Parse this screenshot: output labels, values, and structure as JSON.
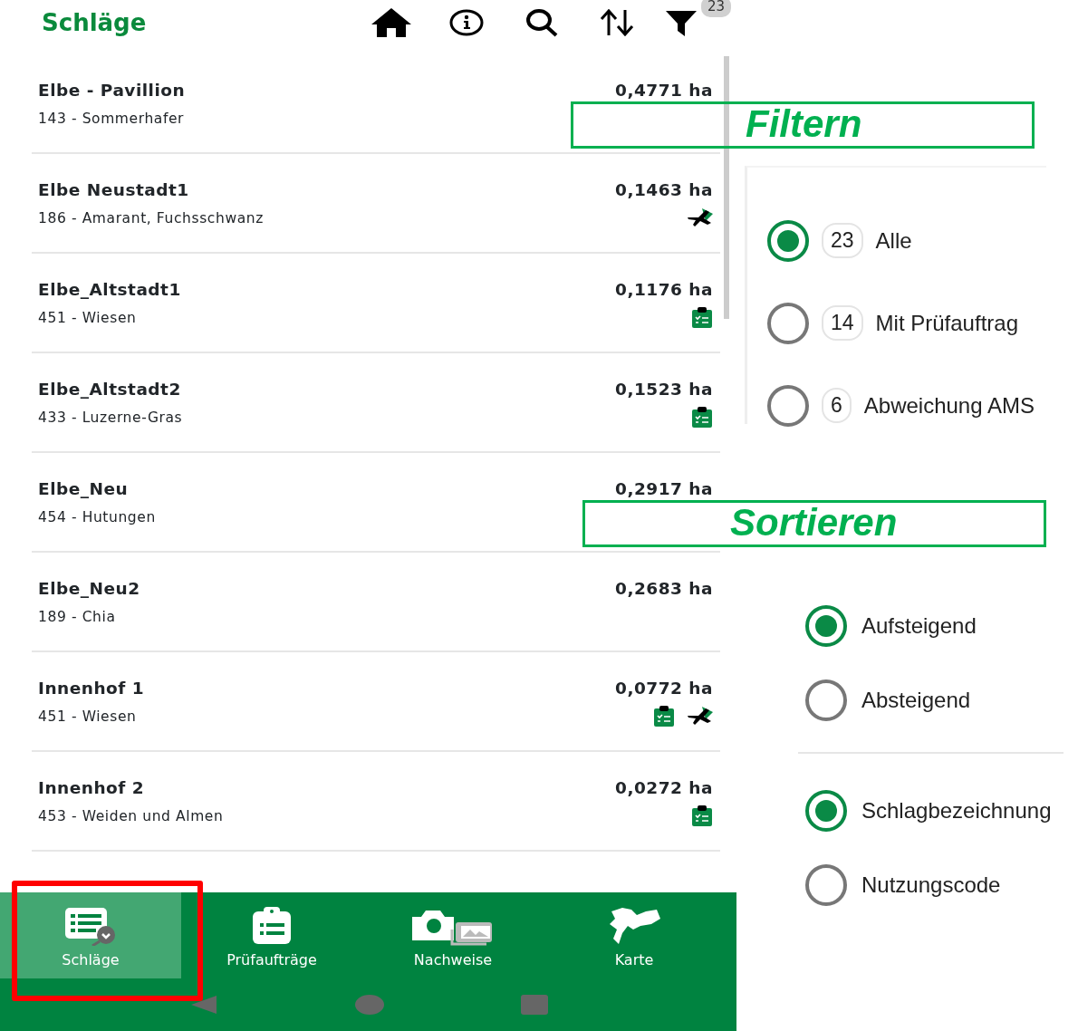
{
  "app_bar": {
    "title": "Schläge",
    "filter_badge": "23"
  },
  "fields": [
    {
      "name": "Elbe - Pavillion",
      "crop": "143 - Sommerhafer",
      "area": "0,4771 ha"
    },
    {
      "name": "Elbe Neustadt1",
      "crop": "186 - Amarant, Fuchsschwanz",
      "area": "0,1463 ha",
      "markers": [
        {
          "kind": "plane"
        }
      ]
    },
    {
      "name": "Elbe_Altstadt1",
      "crop": "451 - Wiesen",
      "area": "0,1176 ha",
      "markers": [
        {
          "kind": "clipboard"
        }
      ]
    },
    {
      "name": "Elbe_Altstadt2",
      "crop": "433 - Luzerne-Gras",
      "area": "0,1523 ha",
      "markers": [
        {
          "kind": "clipboard"
        }
      ]
    },
    {
      "name": "Elbe_Neu",
      "crop": "454 - Hutungen",
      "area": "0,2917 ha"
    },
    {
      "name": "Elbe_Neu2",
      "crop": "189 - Chia",
      "area": "0,2683 ha"
    },
    {
      "name": "Innenhof 1",
      "crop": "451 - Wiesen",
      "area": "0,0772 ha",
      "markers": [
        {
          "kind": "clipboard"
        },
        {
          "kind": "plane"
        }
      ]
    },
    {
      "name": "Innenhof 2",
      "crop": "453 - Weiden und Almen",
      "area": "0,0272 ha",
      "markers": [
        {
          "kind": "clipboard"
        }
      ]
    }
  ],
  "bottom_nav": [
    {
      "kind": "fields",
      "label": "Schläge",
      "selected": true
    },
    {
      "kind": "tasks",
      "label": "Prüfaufträge",
      "selected": false
    },
    {
      "kind": "photos",
      "label": "Nachweise",
      "selected": false
    },
    {
      "kind": "map",
      "label": "Karte",
      "selected": false
    }
  ],
  "filter_panel": {
    "options": [
      {
        "count": "23",
        "label": "Alle",
        "selected": true
      },
      {
        "count": "14",
        "label": "Mit Prüfauftrag",
        "selected": false
      },
      {
        "count": "6",
        "label": "Abweichung AMS",
        "selected": false
      }
    ]
  },
  "sort_panel": {
    "order": [
      {
        "label": "Aufsteigend",
        "selected": true
      },
      {
        "label": "Absteigend",
        "selected": false
      }
    ],
    "field": [
      {
        "label": "Schlagbezeichnung",
        "selected": true
      },
      {
        "label": "Nutzungscode",
        "selected": false
      }
    ]
  },
  "annotations": [
    {
      "label": "Filtern"
    },
    {
      "label": "Sortieren"
    }
  ]
}
